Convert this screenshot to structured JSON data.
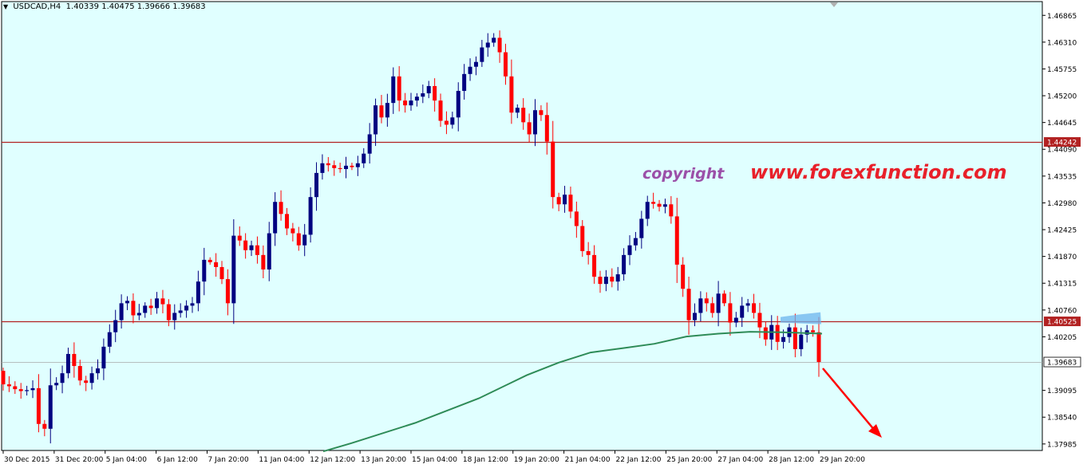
{
  "window": {
    "symbol_timeframe": "USDCAD,H4",
    "ohlc": [
      "1.40339",
      "1.40475",
      "1.39666",
      "1.39683"
    ],
    "menu_icon": "triangle-down-icon"
  },
  "watermark": {
    "copyright": "copyright",
    "site": "www.forexfunction.com"
  },
  "colors": {
    "background": "#E0FFFF",
    "bull": "#000080",
    "bear": "#FF0000",
    "ma": "#2E8B57",
    "level": "#B22222",
    "zone": "#6CB4EE",
    "arrow": "#FF0000"
  },
  "chart_data": {
    "type": "candlestick",
    "ylim": [
      1.3785,
      1.4715
    ],
    "y_ticks": [
      "1.46865",
      "1.46310",
      "1.45755",
      "1.45200",
      "1.44645",
      "1.44090",
      "1.43535",
      "1.42980",
      "1.42425",
      "1.41870",
      "1.41315",
      "1.40760",
      "1.40205",
      "1.39095",
      "1.38540",
      "1.37985"
    ],
    "x_labels": [
      "30 Dec 2015",
      "31 Dec 20:00",
      "5 Jan 04:00",
      "6 Jan 12:00",
      "7 Jan 20:00",
      "11 Jan 04:00",
      "12 Jan 12:00",
      "13 Jan 20:00",
      "15 Jan 04:00",
      "18 Jan 12:00",
      "19 Jan 20:00",
      "21 Jan 04:00",
      "22 Jan 12:00",
      "25 Jan 20:00",
      "27 Jan 04:00",
      "28 Jan 12:00",
      "29 Jan 20:00"
    ],
    "levels": [
      {
        "value": 1.44242,
        "label": "1.44242"
      },
      {
        "value": 1.40525,
        "label": "1.40525"
      }
    ],
    "current_price": {
      "value": 1.39683,
      "label": "1.39683"
    },
    "closes": [
      1.3922,
      1.3918,
      1.3912,
      1.3908,
      1.391,
      1.3914,
      1.384,
      1.383,
      1.392,
      1.3925,
      1.3945,
      1.3985,
      1.396,
      1.393,
      1.3925,
      1.3945,
      1.3955,
      1.4,
      1.403,
      1.4055,
      1.409,
      1.4095,
      1.4065,
      1.407,
      1.4085,
      1.408,
      1.41,
      1.4088,
      1.4055,
      1.407,
      1.4075,
      1.4085,
      1.409,
      1.4135,
      1.418,
      1.4175,
      1.4165,
      1.414,
      1.409,
      1.423,
      1.422,
      1.42,
      1.421,
      1.419,
      1.416,
      1.4235,
      1.43,
      1.4275,
      1.4245,
      1.4235,
      1.421,
      1.4232,
      1.431,
      1.436,
      1.438,
      1.4376,
      1.437,
      1.4368,
      1.4375,
      1.4372,
      1.438,
      1.44,
      1.444,
      1.45,
      1.4475,
      1.4505,
      1.456,
      1.451,
      1.45,
      1.451,
      1.4518,
      1.4525,
      1.454,
      1.451,
      1.4468,
      1.446,
      1.4475,
      1.453,
      1.4565,
      1.458,
      1.459,
      1.462,
      1.463,
      1.464,
      1.461,
      1.456,
      1.4485,
      1.4495,
      1.4465,
      1.444,
      1.449,
      1.448,
      1.4425,
      1.431,
      1.4295,
      1.4315,
      1.428,
      1.425,
      1.4198,
      1.419,
      1.4145,
      1.413,
      1.4145,
      1.4135,
      1.415,
      1.419,
      1.421,
      1.4225,
      1.4265,
      1.43,
      1.4296,
      1.429,
      1.4295,
      1.427,
      1.417,
      1.412,
      1.4055,
      1.407,
      1.41,
      1.409,
      1.407,
      1.411,
      1.409,
      1.405,
      1.406,
      1.4085,
      1.409,
      1.407,
      1.404,
      1.4015,
      1.4045,
      1.401,
      1.402,
      1.404,
      1.3995,
      1.4025,
      1.4034,
      1.403,
      1.39683
    ],
    "moving_average": [
      {
        "x": 405,
        "y": 1.3783
      },
      {
        "x": 440,
        "y": 1.38
      },
      {
        "x": 520,
        "y": 1.3842
      },
      {
        "x": 600,
        "y": 1.3893
      },
      {
        "x": 660,
        "y": 1.3941
      },
      {
        "x": 700,
        "y": 1.3967
      },
      {
        "x": 740,
        "y": 1.3988
      },
      {
        "x": 780,
        "y": 1.3997
      },
      {
        "x": 820,
        "y": 1.4006
      },
      {
        "x": 860,
        "y": 1.4021
      },
      {
        "x": 900,
        "y": 1.4027
      },
      {
        "x": 940,
        "y": 1.4031
      },
      {
        "x": 980,
        "y": 1.403
      },
      {
        "x": 1030,
        "y": 1.4027
      }
    ]
  }
}
